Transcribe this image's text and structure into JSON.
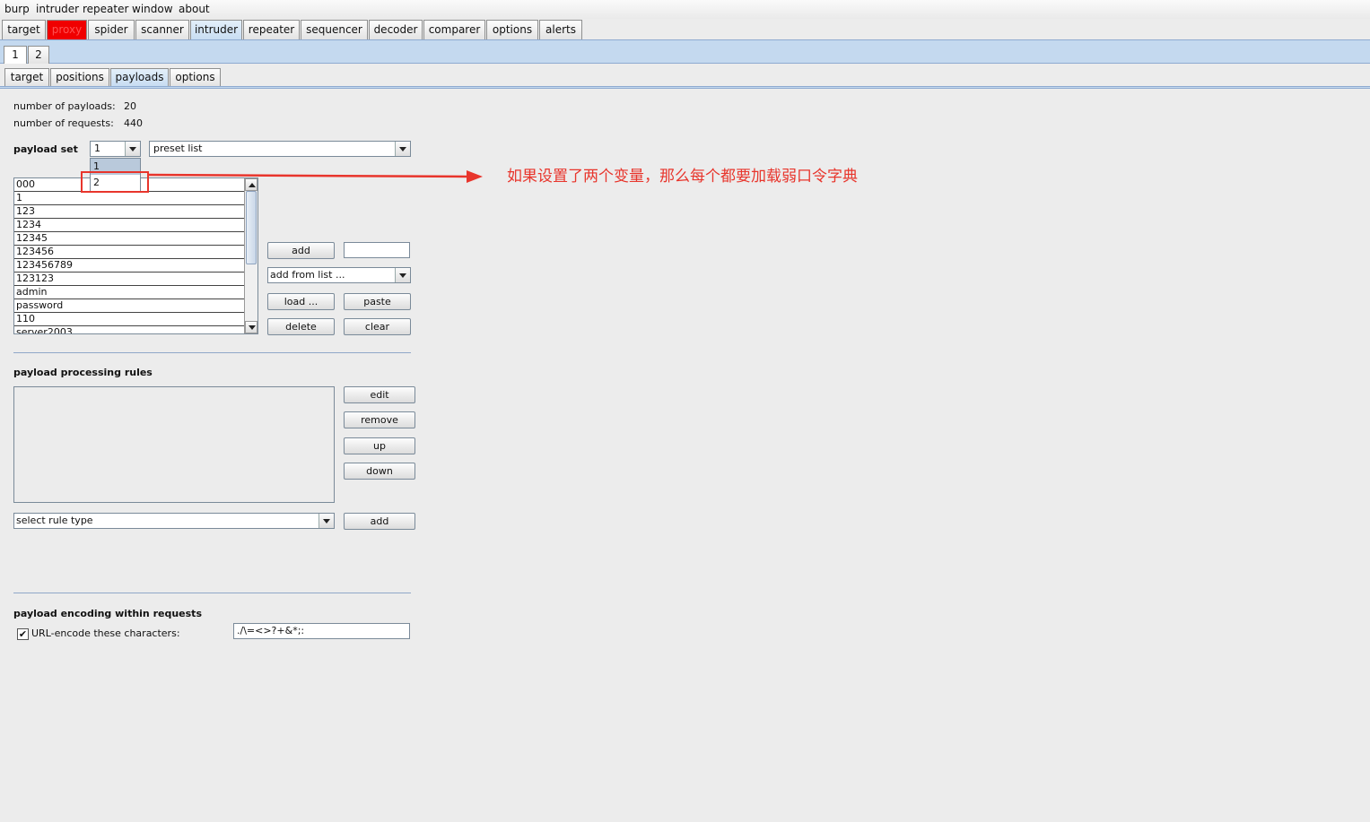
{
  "menu": [
    "burp",
    "intruder",
    "repeater",
    "window",
    "about"
  ],
  "main_tabs": [
    "target",
    "proxy",
    "spider",
    "scanner",
    "intruder",
    "repeater",
    "sequencer",
    "decoder",
    "comparer",
    "options",
    "alerts"
  ],
  "attack_tabs": [
    "1",
    "2"
  ],
  "sub_tabs": [
    "target",
    "positions",
    "payloads",
    "options"
  ],
  "stats": {
    "payloads_label": "number of payloads:",
    "payloads_value": "20",
    "requests_label": "number of requests:",
    "requests_value": "440"
  },
  "payload_set": {
    "label": "payload set",
    "selected": "1",
    "options": [
      "1",
      "2"
    ],
    "type": "preset list"
  },
  "payload_list": [
    "000",
    "1",
    "123",
    "1234",
    "12345",
    "123456",
    "123456789",
    "123123",
    "admin",
    "password",
    "110",
    "server2003"
  ],
  "list_buttons": {
    "add": "add",
    "add_from_list": "add from list ...",
    "load": "load ...",
    "paste": "paste",
    "delete": "delete",
    "clear": "clear"
  },
  "processing": {
    "title": "payload processing rules",
    "edit": "edit",
    "remove": "remove",
    "up": "up",
    "down": "down",
    "rule_type": "select rule type",
    "add": "add"
  },
  "encoding": {
    "title": "payload encoding within requests",
    "checkbox_label": "URL-encode these characters:",
    "checked": true,
    "chars": "./\\=<>?+&*;:"
  },
  "annotation": {
    "text": "如果设置了两个变量，那么每个都要加载弱口令字典",
    "color": "#e8352c"
  }
}
